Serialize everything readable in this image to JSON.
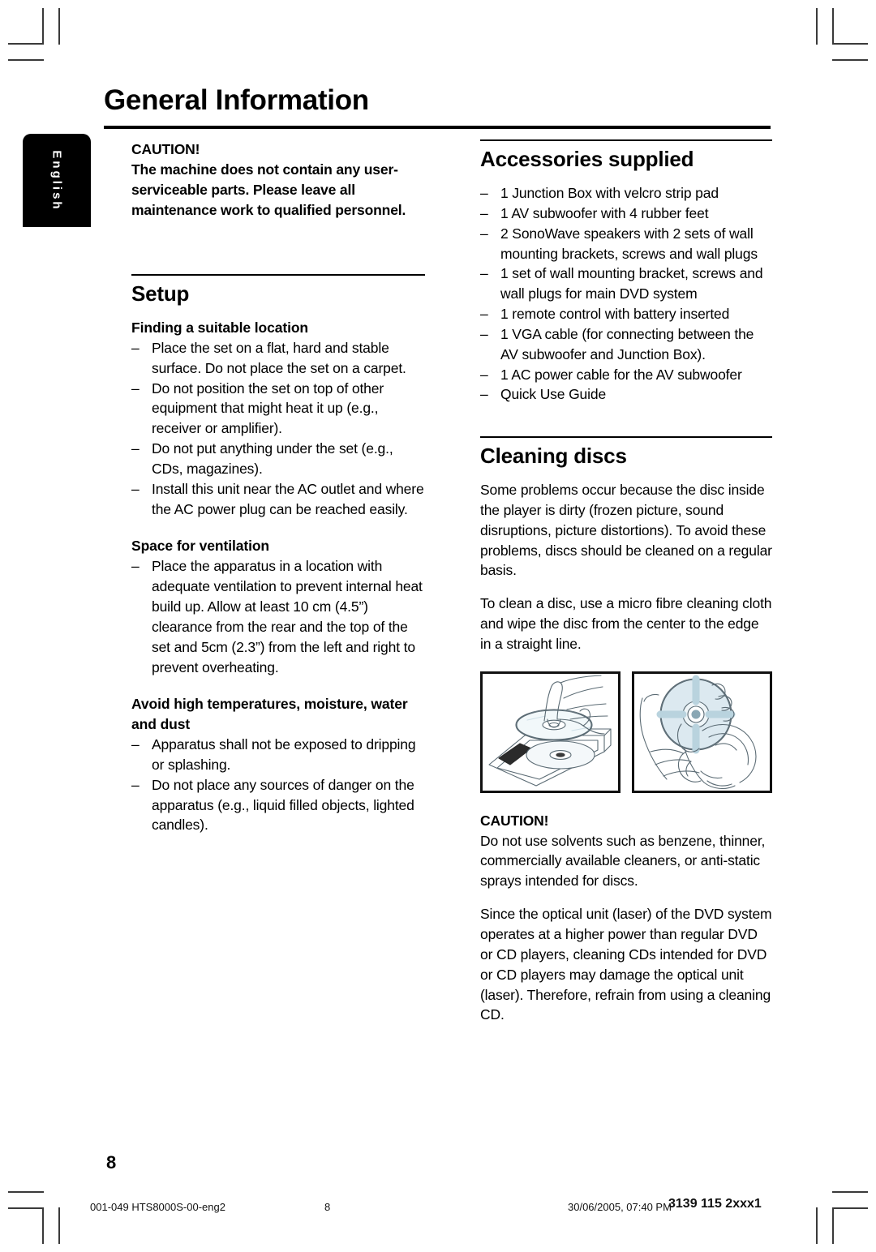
{
  "document": {
    "title": "General Information",
    "language_tab": "English",
    "page_number": "8"
  },
  "left_column": {
    "caution": {
      "heading": "CAUTION!",
      "body": "The machine does not contain any user-serviceable parts.  Please leave all maintenance work to qualified personnel."
    },
    "setup": {
      "title": "Setup",
      "subsections": [
        {
          "heading": "Finding a suitable location",
          "items": [
            "Place the set on a flat, hard and stable surface. Do not place the set on a carpet.",
            "Do not position the set on top of other equipment that might heat it up (e.g., receiver or amplifier).",
            "Do not put anything under the set (e.g., CDs, magazines).",
            "Install this unit near the AC outlet and where the AC power plug can be reached easily."
          ]
        },
        {
          "heading": "Space for ventilation",
          "items": [
            "Place the apparatus in a location with adequate ventilation to prevent internal heat build up. Allow at least 10 cm (4.5”) clearance from the rear and the top of the set and 5cm (2.3”) from the left and right to prevent overheating."
          ]
        },
        {
          "heading": "Avoid high temperatures, moisture, water and dust",
          "items": [
            "Apparatus shall not be exposed to dripping or splashing.",
            "Do not place any sources of danger on the apparatus (e.g., liquid filled objects, lighted candles)."
          ]
        }
      ]
    }
  },
  "right_column": {
    "accessories": {
      "title": "Accessories supplied",
      "items": [
        "1 Junction Box with velcro strip pad",
        "1 AV subwoofer with 4 rubber feet",
        "2 SonoWave speakers with 2 sets of wall mounting brackets, screws and wall plugs",
        "1 set of wall mounting bracket, screws and wall plugs for main DVD system",
        "1 remote control with battery inserted",
        "1 VGA cable (for connecting between the AV subwoofer and Junction Box).",
        "1 AC power cable for the AV subwoofer",
        "Quick Use Guide"
      ]
    },
    "cleaning": {
      "title": "Cleaning discs",
      "paragraphs": [
        "Some problems occur because the disc inside the player is dirty (frozen picture, sound disruptions, picture distortions). To avoid these problems, discs should be cleaned on a regular basis.",
        "To clean a disc, use a micro fibre cleaning cloth and wipe the disc from the center to the edge in a straight line."
      ],
      "illustrations": [
        "disc-removal-from-case-illustration",
        "disc-wiping-with-cloth-illustration"
      ],
      "caution": {
        "heading": "CAUTION!",
        "paragraphs": [
          "Do not use solvents such as benzene, thinner, commercially available cleaners, or anti-static sprays intended for discs.",
          "Since the optical unit (laser) of the DVD system operates at a higher power than regular DVD or CD players, cleaning CDs intended for DVD or CD players may damage the optical unit (laser). Therefore, refrain from using a cleaning CD."
        ]
      }
    }
  },
  "footer": {
    "file_name": "001-049 HTS8000S-00-eng2",
    "page": "8",
    "timestamp": "30/06/2005, 07:40 PM",
    "code": "3139 115 2xxx1"
  },
  "bullet_dash": "–",
  "colors": {
    "ink": "#000000",
    "tab_background": "#000000",
    "tab_text": "#ffffff",
    "illustration_line": "#5b6b74",
    "illustration_disc": "#c9dce4",
    "cropmark": "#3a3a3a"
  }
}
